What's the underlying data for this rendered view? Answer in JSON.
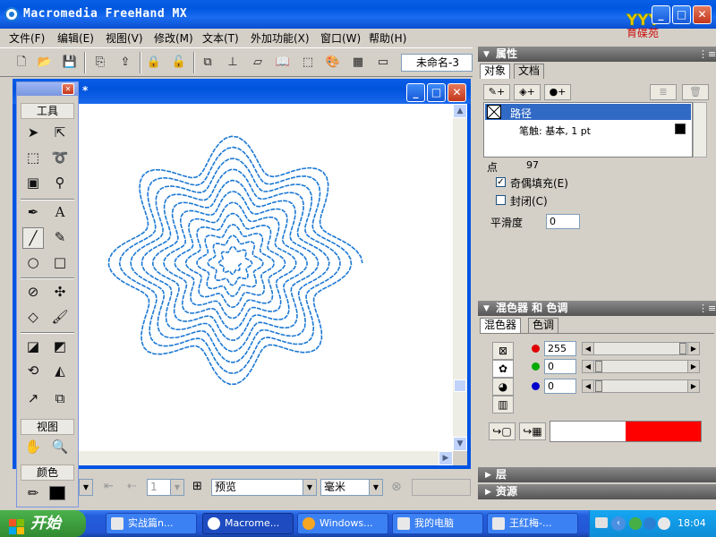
{
  "window": {
    "title": "Macromedia FreeHand MX",
    "logo_text": "育碟苑"
  },
  "menu": [
    "文件(F)",
    "编辑(E)",
    "视图(V)",
    "修改(M)",
    "文本(T)",
    "外加功能(X)",
    "窗口(W)",
    "帮助(H)"
  ],
  "toolbar": {
    "document_select": "未命名-3"
  },
  "document": {
    "title_fragment": "*"
  },
  "tools_panel": {
    "header": "工具",
    "view_label": "视图",
    "color_label": "颜色"
  },
  "status_bar": {
    "page_value": "1",
    "render_mode": "预览",
    "units": "毫米"
  },
  "properties_panel": {
    "title": "属性",
    "tabs": [
      "对象",
      "文档"
    ],
    "object_name": "路径",
    "stroke_info": "笔触: 基本, 1 pt",
    "points_label": "点",
    "points_value": "97",
    "even_odd_fill_label": "奇偶填充(E)",
    "closed_label": "封闭(C)",
    "smoothness_label": "平滑度",
    "smoothness_value": "0"
  },
  "mixer_panel": {
    "title": "混色器 和 色调",
    "tabs": [
      "混色器",
      "色调"
    ],
    "r_value": "255",
    "g_value": "0",
    "b_value": "0",
    "colors": {
      "red": "#ff0000",
      "green": "#00aa00",
      "blue": "#0000cc",
      "old_color": "#ffffff",
      "new_color": "#ff0000"
    }
  },
  "collapsed_panels": [
    "层",
    "资源"
  ],
  "taskbar": {
    "start_label": "开始",
    "tasks": [
      "实战篇n...",
      "Macrome...",
      "Windows...",
      "我的电脑",
      "王红梅-..."
    ],
    "clock": "18:04"
  },
  "accent": "#1c78d4"
}
